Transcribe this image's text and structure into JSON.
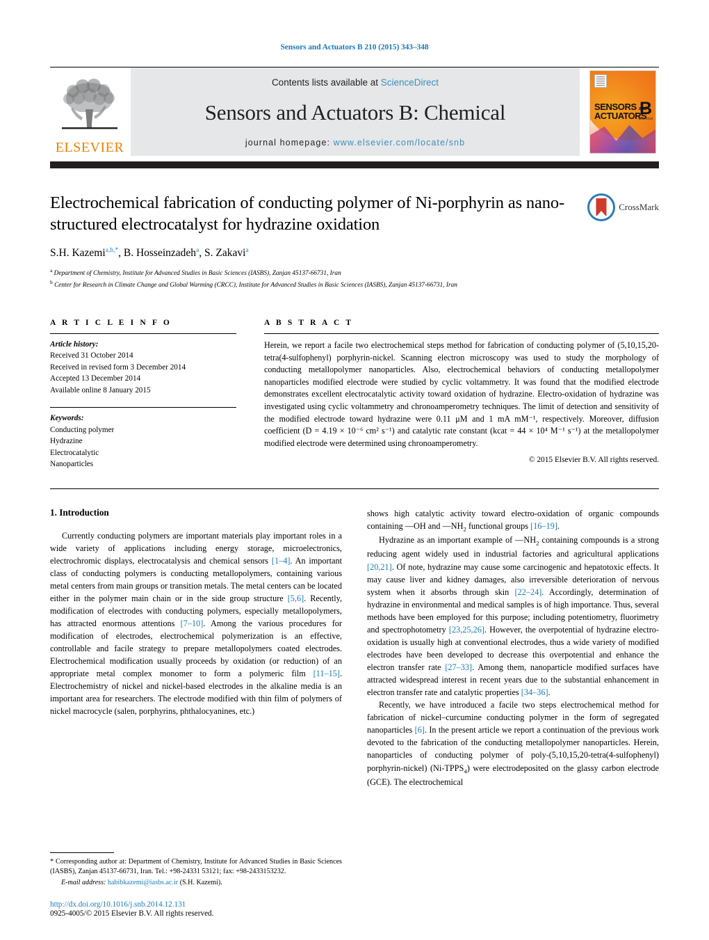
{
  "running_head": "Sensors and Actuators B 210 (2015) 343–348",
  "masthead": {
    "publisher_name": "ELSEVIER",
    "contents_prefix": "Contents lists available at ",
    "contents_link": "ScienceDirect",
    "journal_title": "Sensors and Actuators B: Chemical",
    "homepage_prefix": "journal homepage: ",
    "homepage_url": "www.elsevier.com/locate/snb",
    "cover": {
      "line1": "SENSORS",
      "line1_small": "and",
      "line2": "ACTUATORS",
      "volume_letter": "B",
      "volume_sub": "Chemical"
    }
  },
  "article": {
    "title": "Electrochemical fabrication of conducting polymer of Ni-porphyrin as nano-structured electrocatalyst for hydrazine oxidation",
    "authors_html": "S.H. Kazemi<sup>a,b,*</sup>, B. Hosseinzadeh<sup>a</sup>, S. Zakavi<sup>a</sup>",
    "affiliations": [
      "Department of Chemistry, Institute for Advanced Studies in Basic Sciences (IASBS), Zanjan 45137-66731, Iran",
      "Center for Research in Climate Change and Global Warming (CRCC), Institute for Advanced Studies in Basic Sciences (IASBS), Zanjan 45137-66731, Iran"
    ],
    "crossmark_label": "CrossMark"
  },
  "article_info": {
    "heading": "A R T I C L E   I N F O",
    "history_label": "Article history:",
    "history": [
      "Received 31 October 2014",
      "Received in revised form 3 December 2014",
      "Accepted 13 December 2014",
      "Available online 8 January 2015"
    ],
    "keywords_label": "Keywords:",
    "keywords": [
      "Conducting polymer",
      "Hydrazine",
      "Electrocatalytic",
      "Nanoparticles"
    ]
  },
  "abstract": {
    "heading": "A B S T R A C T",
    "text": "Herein, we report a facile two electrochemical steps method for fabrication of conducting polymer of (5,10,15,20-tetra(4-sulfophenyl) porphyrin-nickel. Scanning electron microscopy was used to study the morphology of conducting metallopolymer nanoparticles. Also, electrochemical behaviors of conducting metallopolymer nanoparticles modified electrode were studied by cyclic voltammetry. It was found that the modified electrode demonstrates excellent electrocatalytic activity toward oxidation of hydrazine. Electro-oxidation of hydrazine was investigated using cyclic voltammetry and chronoamperometry techniques. The limit of detection and sensitivity of the modified electrode toward hydrazine were 0.11 μM and 1 mA mM⁻¹, respectively. Moreover, diffusion coefficient (D = 4.19 × 10⁻⁶ cm² s⁻¹) and catalytic rate constant (kcat = 44 × 10⁴ M⁻¹ s⁻¹) at the metallopolymer modified electrode were determined using chronoamperometry.",
    "copyright": "© 2015 Elsevier B.V. All rights reserved."
  },
  "body": {
    "section_number_title": "1.  Introduction",
    "left_paragraph_1": "Currently conducting polymers are important materials play important roles in a wide variety of applications including energy storage, microelectronics, electrochromic displays, electrocatalysis and chemical sensors [1–4]. An important class of conducting polymers is conducting metallopolymers, containing various metal centers from main groups or transition metals. The metal centers can be located either in the polymer main chain or in the side group structure [5,6]. Recently, modification of electrodes with conducting polymers, especially metallopolymers, has attracted enormous attentions [7–10]. Among the various procedures for modification of electrodes, electrochemical polymerization is an effective, controllable and facile strategy to prepare metallopolymers coated electrodes. Electrochemical modification usually proceeds by oxidation (or reduction) of an appropriate metal complex monomer to form a polymeric film [11–15]. Electrochemistry of nickel and nickel-based electrodes in the alkaline media is an important area for researchers. The electrode modified with thin film of polymers of nickel macrocycle (salen, porphyrins, phthalocyanines, etc.)",
    "right_paragraph_1": "shows high catalytic activity toward electro-oxidation of organic compounds containing —OH and —NH2 functional groups [16–19].",
    "right_paragraph_2": "Hydrazine as an important example of —NH2 containing compounds is a strong reducing agent widely used in industrial factories and agricultural applications [20,21]. Of note, hydrazine may cause some carcinogenic and hepatotoxic effects. It may cause liver and kidney damages, also irreversible deterioration of nervous system when it absorbs through skin [22–24]. Accordingly, determination of hydrazine in environmental and medical samples is of high importance. Thus, several methods have been employed for this purpose; including potentiometry, fluorimetry and spectrophotometry [23,25,26]. However, the overpotential of hydrazine electro-oxidation is usually high at conventional electrodes, thus a wide variety of modified electrodes have been developed to decrease this overpotential and enhance the electron transfer rate [27–33]. Among them, nanoparticle modified surfaces have attracted widespread interest in recent years due to the substantial enhancement in electron transfer rate and catalytic properties [34–36].",
    "right_paragraph_3": "Recently, we have introduced a facile two steps electrochemical method for fabrication of nickel–curcumine conducting polymer in the form of segregated nanoparticles [6]. In the present article we report a continuation of the previous work devoted to the fabrication of the conducting metallopolymer nanoparticles. Herein, nanoparticles of conducting polymer of poly-(5,10,15,20-tetra(4-sulfophenyl) porphyrin-nickel) (Ni-TPPS4) were electrodeposited on the glassy carbon electrode (GCE). The electrochemical"
  },
  "footnote": {
    "corresponding": "* Corresponding author at: Department of Chemistry, Institute for Advanced Studies in Basic Sciences (IASBS), Zanjan 45137-66731, Iran. Tel.: +98-24331 53121; fax: +98-2433153232.",
    "email_label": "E-mail address:",
    "email": "habibkazemi@iasbs.ac.ir",
    "email_suffix": "(S.H. Kazemi).",
    "doi": "http://dx.doi.org/10.1016/j.snb.2014.12.131",
    "issn": "0925-4005/© 2015 Elsevier B.V. All rights reserved."
  },
  "colors": {
    "link_blue": "#1a7bb9",
    "elsevier_orange": "#f08000",
    "masthead_grey": "#e6e7e8",
    "rule_black": "#231f20"
  }
}
